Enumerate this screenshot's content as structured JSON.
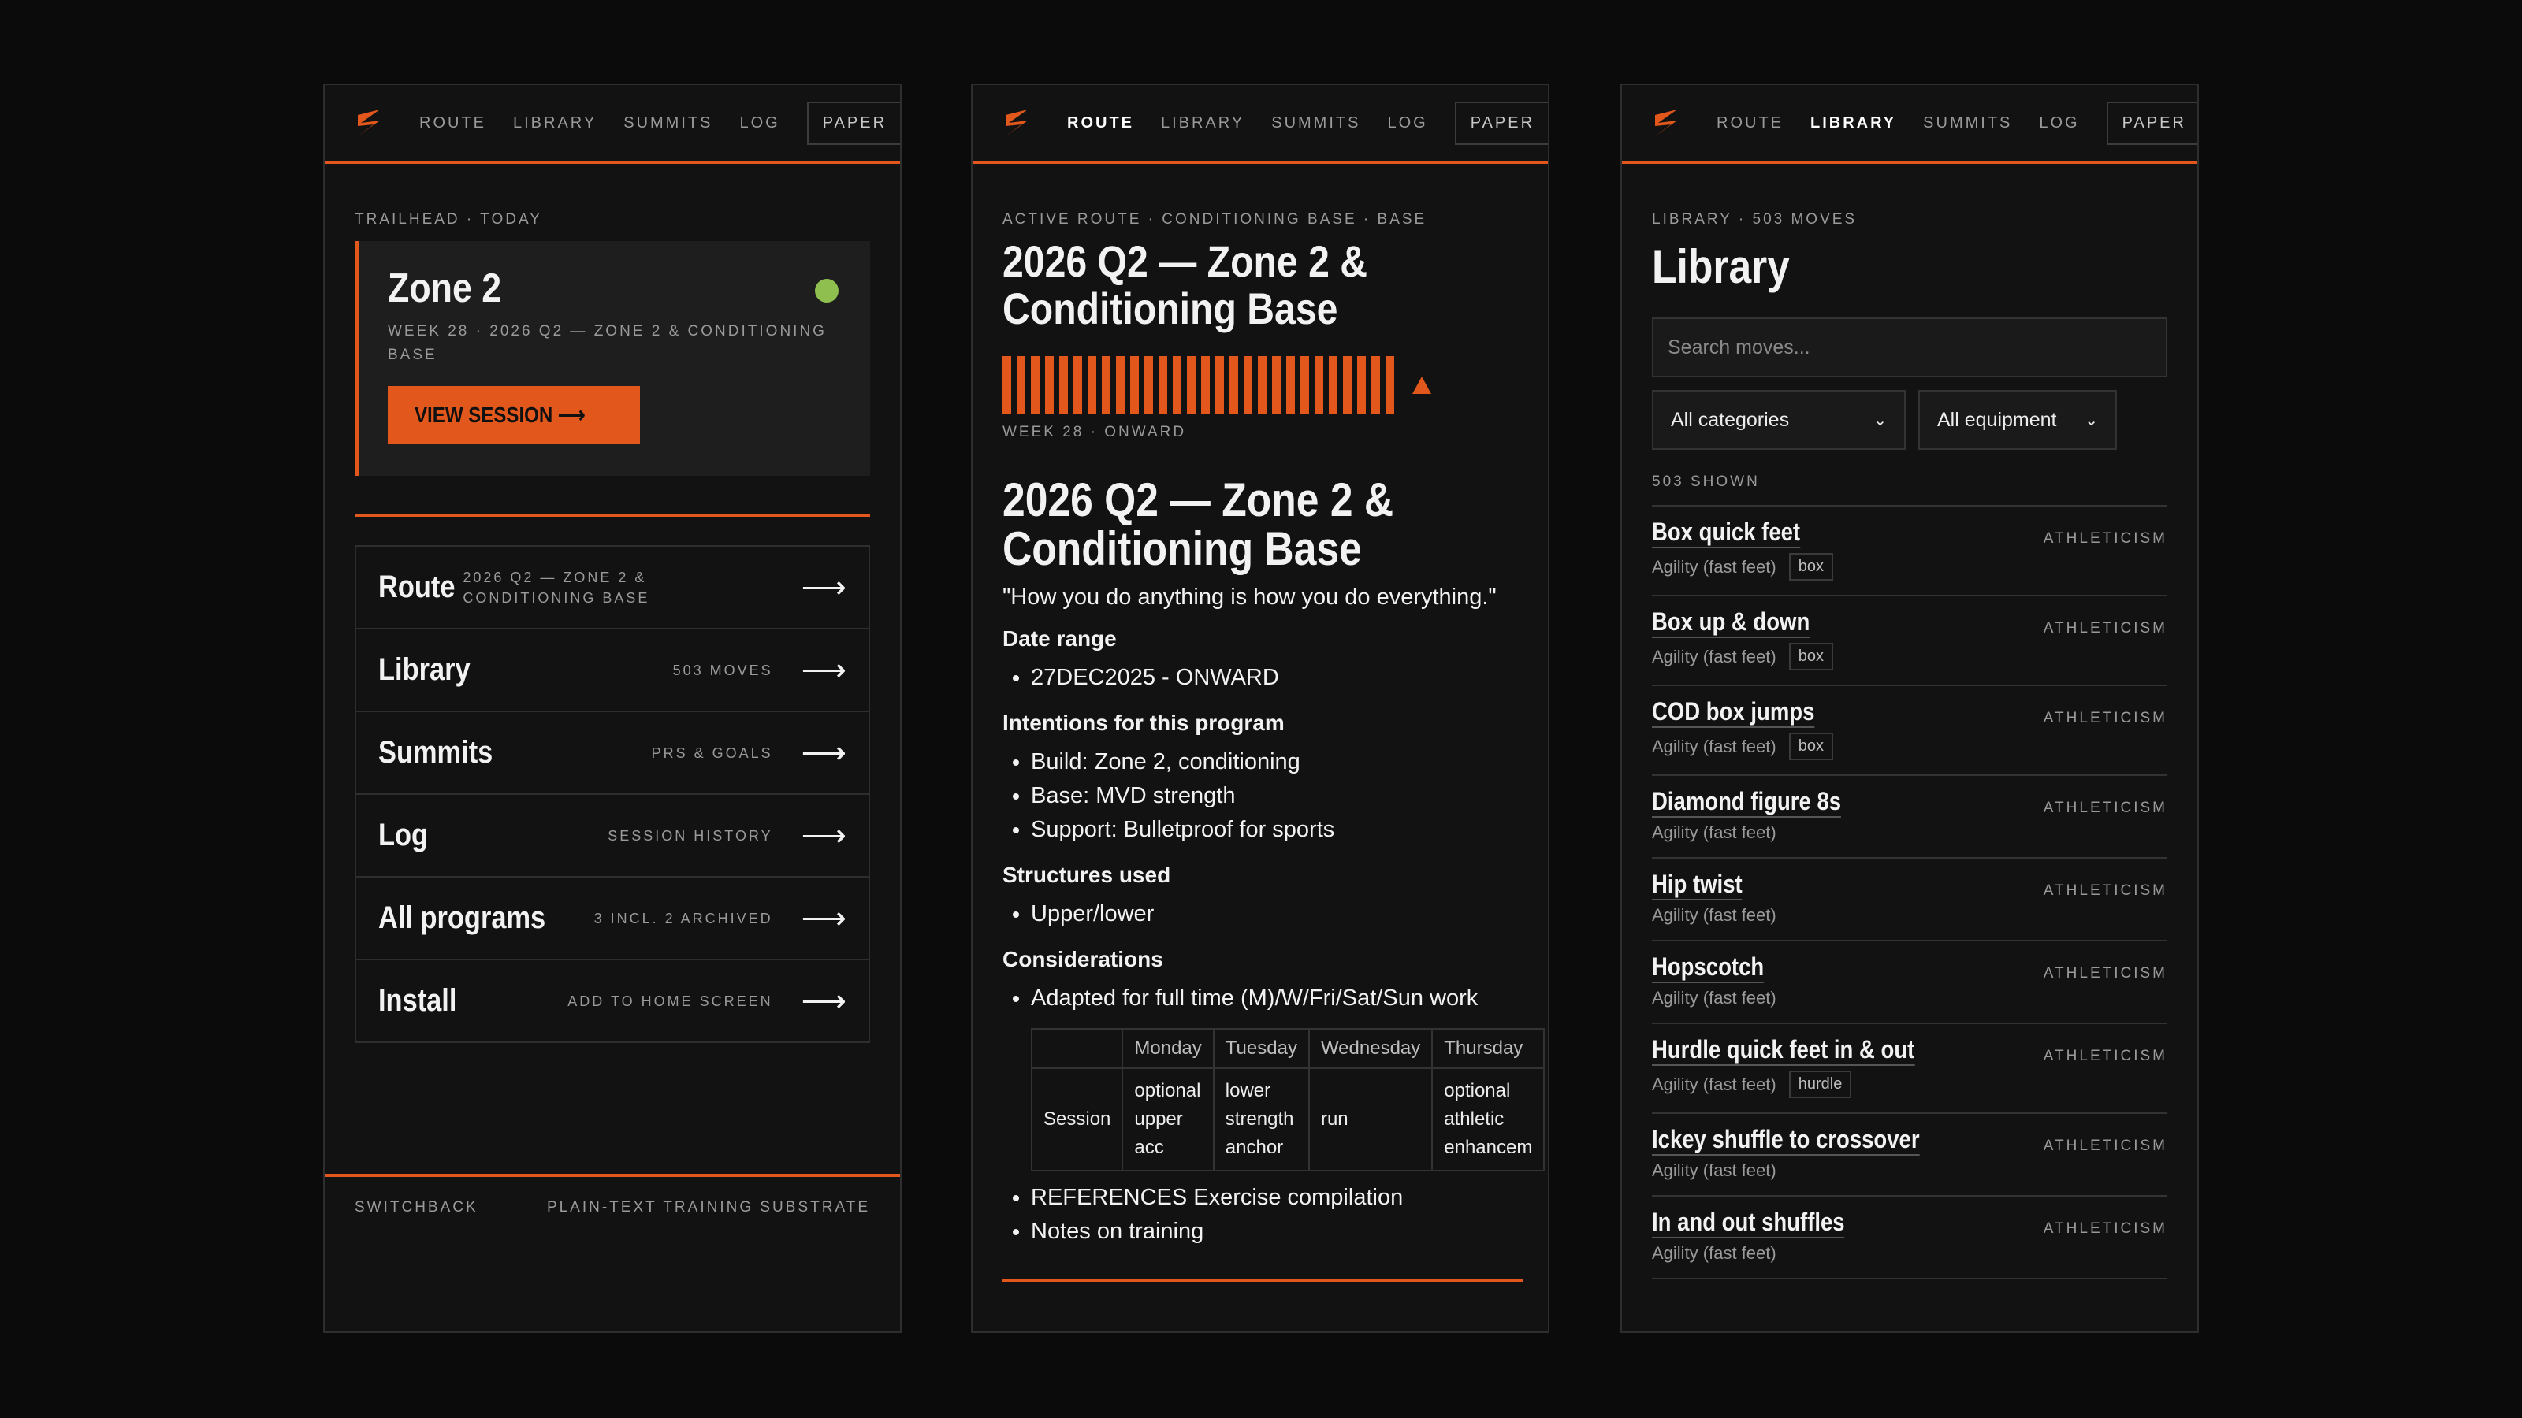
{
  "brand": {
    "accent": "#e2571c",
    "bg": "#0b0b0b",
    "panel": "#121212",
    "status_green": "#8fbf4f"
  },
  "nav": {
    "links": [
      "ROUTE",
      "LIBRARY",
      "SUMMITS",
      "LOG"
    ],
    "paper": "PAPER"
  },
  "home": {
    "eyebrow": "TRAILHEAD · TODAY",
    "hero": {
      "title": "Zone 2",
      "sub": "WEEK 28 · 2026 Q2 — ZONE 2 & CONDITIONING BASE",
      "cta": "VIEW SESSION ⟶"
    },
    "menu": [
      {
        "label": "Route",
        "meta": "2026 Q2 — ZONE 2 & CONDITIONING BASE"
      },
      {
        "label": "Library",
        "meta": "503 MOVES"
      },
      {
        "label": "Summits",
        "meta": "PRS & GOALS"
      },
      {
        "label": "Log",
        "meta": "SESSION HISTORY"
      },
      {
        "label": "All programs",
        "meta": "3 INCL. 2 ARCHIVED"
      },
      {
        "label": "Install",
        "meta": "ADD TO HOME SCREEN"
      }
    ],
    "footer": {
      "left": "SWITCHBACK",
      "right": "PLAIN-TEXT TRAINING SUBSTRATE"
    }
  },
  "route": {
    "eyebrow": "ACTIVE ROUTE · CONDITIONING BASE · BASE",
    "title": "2026 Q2 — Zone 2 & Conditioning Base",
    "week_label": "WEEK 28 · ONWARD",
    "heading": "2026 Q2 — Zone 2 & Conditioning Base",
    "quote": "\"How you do anything is how you do everything.\"",
    "date_range_label": "Date range",
    "date_range": [
      "27DEC2025 - ONWARD"
    ],
    "intentions_label": "Intentions for this program",
    "intentions": [
      "Build: Zone 2, conditioning",
      "Base: MVD strength",
      "Support: Bulletproof for sports"
    ],
    "structures_label": "Structures used",
    "structures": [
      "Upper/lower"
    ],
    "considerations_label": "Considerations",
    "considerations": [
      "Adapted for full time (M)/W/Fri/Sat/Sun work"
    ],
    "table": {
      "headers": [
        "",
        "Monday",
        "Tuesday",
        "Wednesday",
        "Thursday"
      ],
      "row_label": "Session",
      "cells": [
        [
          "optional",
          "upper",
          "acc"
        ],
        [
          "lower",
          "strength",
          "anchor"
        ],
        [
          "run"
        ],
        [
          "optional",
          "athletic",
          "enhancem"
        ]
      ]
    },
    "more": [
      "REFERENCES Exercise compilation",
      "Notes on training"
    ]
  },
  "library": {
    "eyebrow": "LIBRARY · 503 MOVES",
    "title": "Library",
    "search_placeholder": "Search moves...",
    "category_select": "All categories",
    "equipment_select": "All equipment",
    "shown": "503 SHOWN",
    "items": [
      {
        "name": "Box quick feet",
        "sub": "Agility (fast feet)",
        "tag": "box",
        "cat": "ATHLETICISM"
      },
      {
        "name": "Box up & down",
        "sub": "Agility (fast feet)",
        "tag": "box",
        "cat": "ATHLETICISM"
      },
      {
        "name": "COD box jumps",
        "sub": "Agility (fast feet)",
        "tag": "box",
        "cat": "ATHLETICISM"
      },
      {
        "name": "Diamond figure 8s",
        "sub": "Agility (fast feet)",
        "tag": "",
        "cat": "ATHLETICISM"
      },
      {
        "name": "Hip twist",
        "sub": "Agility (fast feet)",
        "tag": "",
        "cat": "ATHLETICISM"
      },
      {
        "name": "Hopscotch",
        "sub": "Agility (fast feet)",
        "tag": "",
        "cat": "ATHLETICISM"
      },
      {
        "name": "Hurdle quick feet in & out",
        "sub": "Agility (fast feet)",
        "tag": "hurdle",
        "cat": "ATHLETICISM"
      },
      {
        "name": "Ickey shuffle to crossover",
        "sub": "Agility (fast feet)",
        "tag": "",
        "cat": "ATHLETICISM"
      },
      {
        "name": "In and out shuffles",
        "sub": "Agility (fast feet)",
        "tag": "",
        "cat": "ATHLETICISM"
      }
    ]
  }
}
